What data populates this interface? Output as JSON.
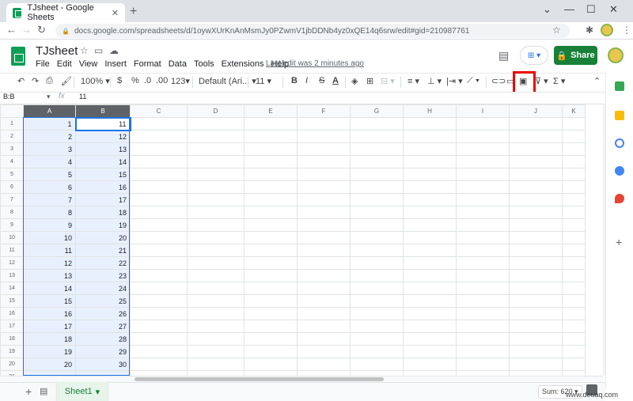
{
  "browser": {
    "tab_title": "TJsheet - Google Sheets",
    "tab_close": "✕",
    "new_tab": "+",
    "url": "docs.google.com/spreadsheets/d/1oywXUrKnAnMsmJy0PZwmV1jbDDNb4yz0xQE14q6srw/edit#gid=210987761",
    "window_controls": [
      "⌄",
      "—",
      "☐",
      "✕"
    ]
  },
  "app": {
    "doc_title": "TJsheet",
    "menu": [
      "File",
      "Edit",
      "View",
      "Insert",
      "Format",
      "Data",
      "Tools",
      "Extensions",
      "Help"
    ],
    "last_edit": "Last edit was 2 minutes ago",
    "share_label": "Share",
    "brand_color": "#0f9d58",
    "share_color": "#188038"
  },
  "toolbar": {
    "zoom": "100%",
    "currency": "$",
    "percent": "%",
    "dec_less": ".0",
    "dec_more": ".00",
    "more_formats": "123",
    "font": "Default (Ari...",
    "font_size": "11",
    "bold": "B",
    "italic": "I",
    "strike": "S",
    "text_color": "A",
    "sum_symbol": "Σ"
  },
  "formula": {
    "name_box": "B:B",
    "fx": "fx",
    "value": "11"
  },
  "grid": {
    "columns": [
      "A",
      "B",
      "C",
      "D",
      "E",
      "F",
      "G",
      "H",
      "I",
      "J",
      "K"
    ],
    "rows": [
      {
        "n": "1",
        "a": "1",
        "b": "11"
      },
      {
        "n": "2",
        "a": "2",
        "b": "12"
      },
      {
        "n": "3",
        "a": "3",
        "b": "13"
      },
      {
        "n": "4",
        "a": "4",
        "b": "14"
      },
      {
        "n": "5",
        "a": "5",
        "b": "15"
      },
      {
        "n": "6",
        "a": "6",
        "b": "16"
      },
      {
        "n": "7",
        "a": "7",
        "b": "17"
      },
      {
        "n": "8",
        "a": "8",
        "b": "18"
      },
      {
        "n": "9",
        "a": "9",
        "b": "19"
      },
      {
        "n": "10",
        "a": "10",
        "b": "20"
      },
      {
        "n": "11",
        "a": "11",
        "b": "21"
      },
      {
        "n": "12",
        "a": "12",
        "b": "22"
      },
      {
        "n": "13",
        "a": "13",
        "b": "23"
      },
      {
        "n": "14",
        "a": "14",
        "b": "24"
      },
      {
        "n": "15",
        "a": "15",
        "b": "25"
      },
      {
        "n": "16",
        "a": "16",
        "b": "26"
      },
      {
        "n": "17",
        "a": "17",
        "b": "27"
      },
      {
        "n": "18",
        "a": "18",
        "b": "28"
      },
      {
        "n": "19",
        "a": "19",
        "b": "29"
      },
      {
        "n": "20",
        "a": "20",
        "b": "30"
      },
      {
        "n": "21",
        "a": "",
        "b": ""
      }
    ]
  },
  "footer": {
    "add_sheet": "+",
    "sheet_tab": "Sheet1",
    "sheet_caret": "▾",
    "sum": "Sum: 620",
    "watermark": "www.deuaq.com"
  }
}
